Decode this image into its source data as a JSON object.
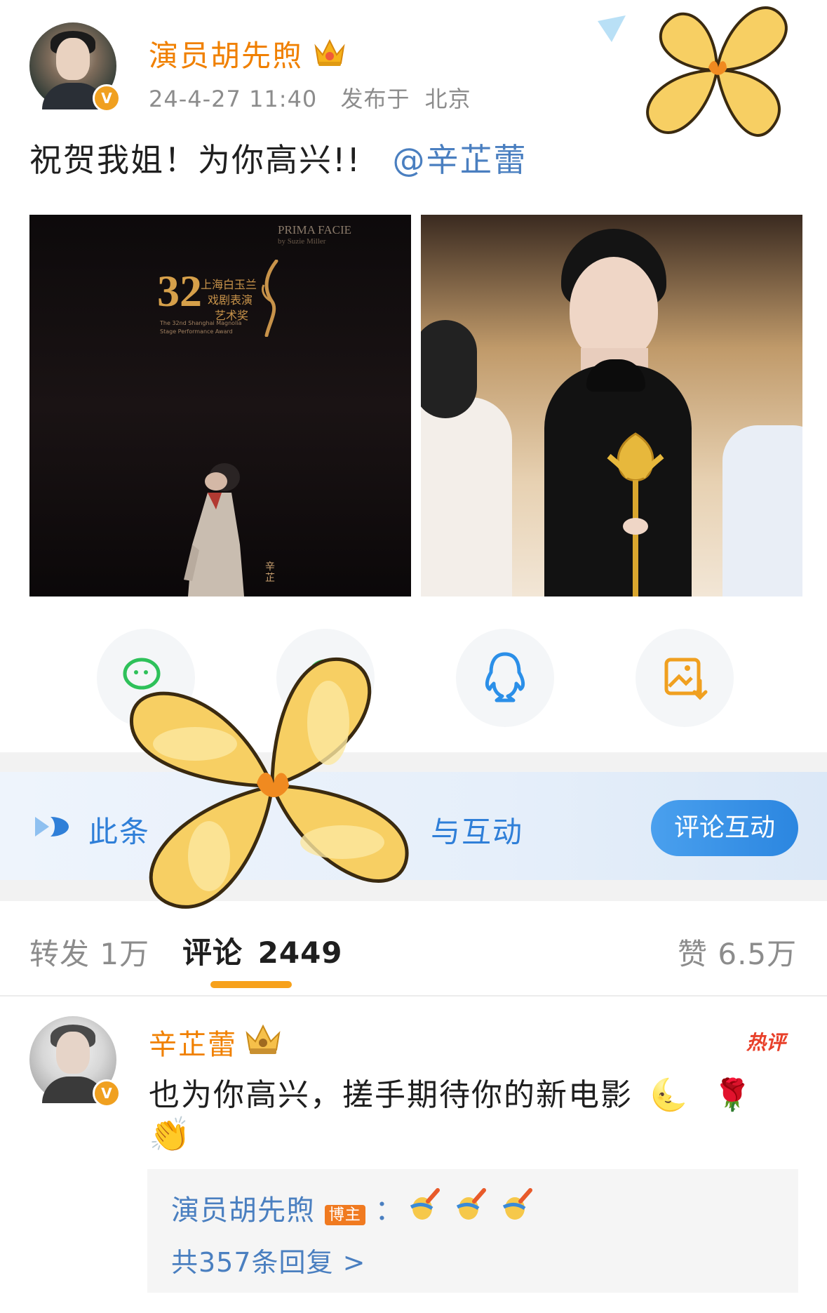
{
  "post": {
    "author": "演员胡先煦",
    "timestamp": "24-4-27 11:40",
    "location_prefix": "发布于",
    "location": "北京",
    "text": "祝贺我姐！为你高兴!!",
    "mention": "@辛芷蕾",
    "verified_badge": "V"
  },
  "images": {
    "poster": {
      "title_en": "PRIMA FACIE",
      "title_en_sub": "by Suzie Miller",
      "award_number": "32",
      "award_cn_1": "上海白玉兰",
      "award_cn_2": "戏剧表演",
      "award_cn_3": "艺术奖",
      "award_en_1": "The 32nd Shanghai Magnolia",
      "award_en_2": "Stage Performance Award",
      "side_text": "辛芷"
    }
  },
  "share": {
    "items": [
      "wechat-icon",
      "moments-icon",
      "qq-icon",
      "save-image-icon"
    ]
  },
  "banner": {
    "text_left": "此条",
    "text_right": "与互动",
    "button": "评论互动"
  },
  "tabs": {
    "repost": "转发 1万",
    "comments_label": "评论",
    "comments_count": "2449",
    "likes": "赞 6.5万"
  },
  "comment": {
    "author": "辛芷蕾",
    "hot_label": "热评",
    "text": "也为你高兴，搓手期待你的新电影",
    "emoji_moon": "🌜",
    "emoji_rose": "🌹",
    "emoji_clap": "👏",
    "reply": {
      "author": "演员胡先煦",
      "badge": "博主",
      "separator": "：",
      "count_text": "共357条回复 >"
    }
  },
  "colors": {
    "username": "#f08000",
    "link": "#4a7fc0",
    "banner_blue": "#2f7fd8",
    "tab_indicator": "#f7a11a",
    "flower": "#f7cf63"
  }
}
